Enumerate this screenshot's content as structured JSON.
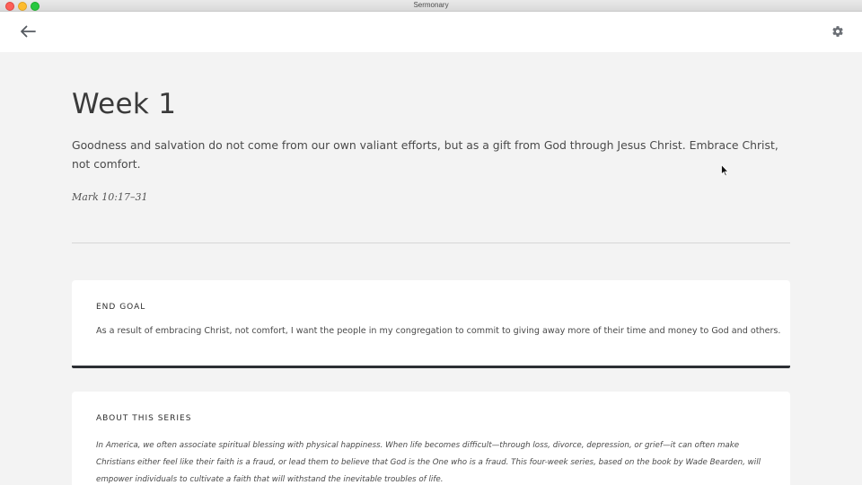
{
  "window": {
    "title": "Sermonary"
  },
  "header": {
    "back_icon": "arrow-left-icon",
    "settings_icon": "gear-icon"
  },
  "main": {
    "title": "Week 1",
    "summary": "Goodness and salvation do not come from our own valiant efforts, but as a gift from God through Jesus Christ. Embrace Christ, not comfort.",
    "scripture": "Mark 10:17–31"
  },
  "end_goal": {
    "heading": "END GOAL",
    "text": "As a result of embracing Christ, not comfort, I want the people in my congregation to commit to giving away more of their time and money to God and others."
  },
  "about_series": {
    "heading": "ABOUT THIS SERIES",
    "text": "In America, we often associate spiritual blessing with physical happiness. When life becomes difficult—through loss, divorce, depression, or grief—it can often make Christians either feel like their faith is a fraud, or lead them to believe that God is the One who is a fraud. This four-week series, based on the book by Wade Bearden, will empower individuals to cultivate a faith that will withstand the inevitable troubles of life."
  },
  "colors": {
    "background": "#f3f3f3",
    "card": "#ffffff",
    "accent_border": "#2c2f34",
    "text": "#3a3a3a"
  }
}
